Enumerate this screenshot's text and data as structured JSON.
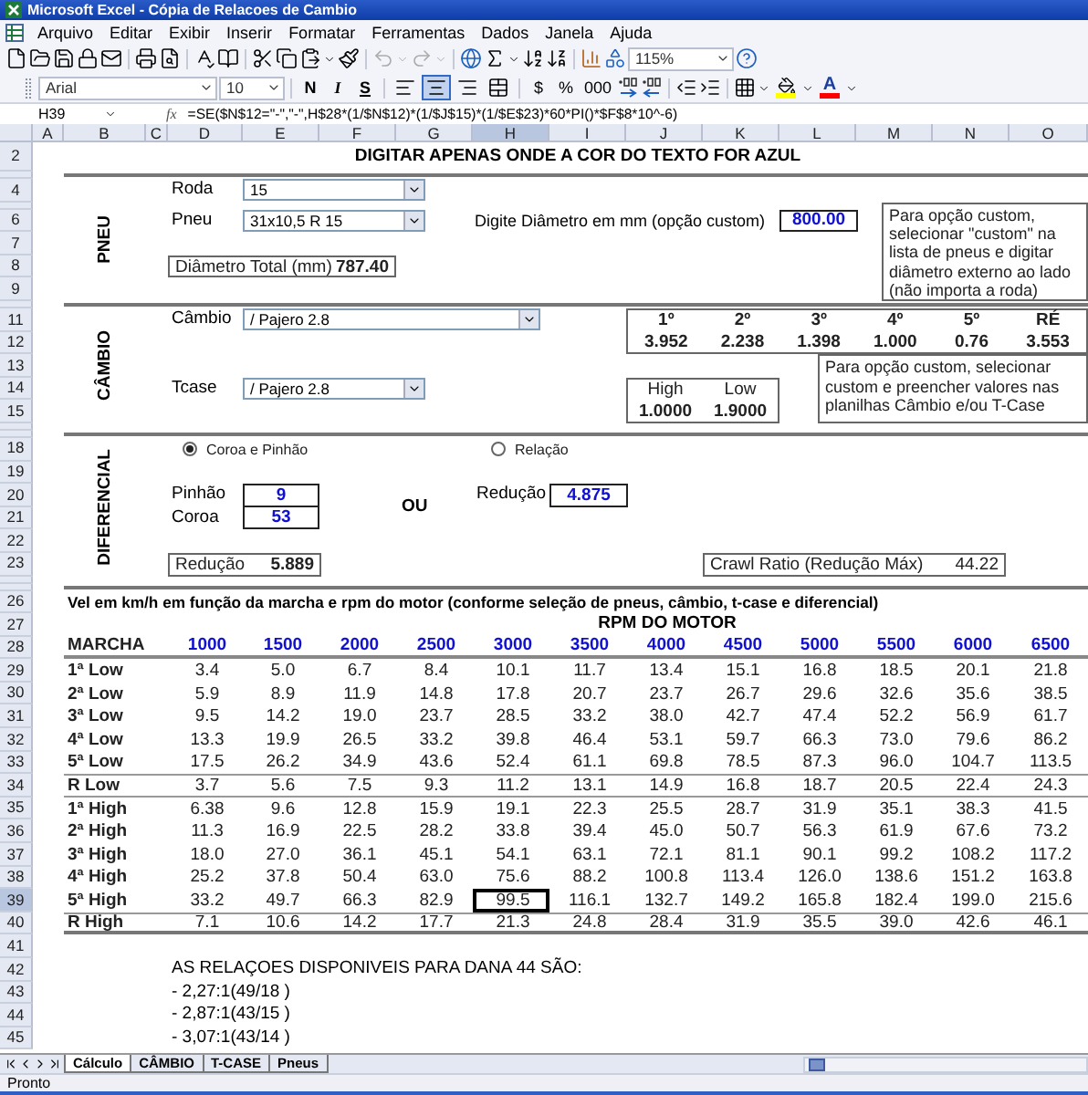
{
  "window": {
    "title": "Microsoft Excel - Cópia de Relacoes de Cambio"
  },
  "menu": [
    "Arquivo",
    "Editar",
    "Exibir",
    "Inserir",
    "Formatar",
    "Ferramentas",
    "Dados",
    "Janela",
    "Ajuda"
  ],
  "standard_toolbar": {
    "zoom": "115%"
  },
  "format_toolbar": {
    "font": "Arial",
    "size": "10",
    "style_buttons": [
      "N",
      "I",
      "S"
    ],
    "alignment_buttons": [
      {
        "kind": "left",
        "selected": false
      },
      {
        "kind": "center",
        "selected": true
      },
      {
        "kind": "right",
        "selected": false
      },
      {
        "kind": "merge",
        "selected": false
      }
    ],
    "number_buttons": [
      "$",
      "%",
      "000"
    ],
    "font_color_label": "A"
  },
  "formula_bar": {
    "name_box": "H39",
    "function_label": "fx",
    "formula": "=SE($N$12=\"-\",\"-\",H$28*(1/$N$12)*(1/$J$15)*(1/$E$23)*60*PI()*$F$8*10^-6)"
  },
  "column_letters": [
    {
      "label": "A",
      "selected": false
    },
    {
      "label": "B",
      "selected": false
    },
    {
      "label": "C",
      "selected": false
    },
    {
      "label": "D",
      "selected": false
    },
    {
      "label": "E",
      "selected": false
    },
    {
      "label": "F",
      "selected": false
    },
    {
      "label": "G",
      "selected": false
    },
    {
      "label": "H",
      "selected": true
    },
    {
      "label": "I",
      "selected": false
    },
    {
      "label": "J",
      "selected": false
    },
    {
      "label": "K",
      "selected": false
    },
    {
      "label": "L",
      "selected": false
    },
    {
      "label": "M",
      "selected": false
    },
    {
      "label": "N",
      "selected": false
    },
    {
      "label": "O",
      "selected": false
    }
  ],
  "row_numbers": [
    {
      "kind": "tall",
      "label": "2",
      "selected": false
    },
    {
      "kind": "collapsed",
      "selected": false
    },
    {
      "kind": "full",
      "label": "4",
      "selected": false
    },
    {
      "kind": "collapsed",
      "selected": false
    },
    {
      "kind": "full",
      "label": "6",
      "selected": false
    },
    {
      "kind": "full",
      "label": "7",
      "selected": false
    },
    {
      "kind": "full",
      "label": "8",
      "selected": false
    },
    {
      "kind": "full",
      "label": "9",
      "selected": false
    },
    {
      "kind": "collapsed",
      "selected": false
    },
    {
      "kind": "full",
      "label": "11",
      "selected": false
    },
    {
      "kind": "full",
      "label": "12",
      "selected": false
    },
    {
      "kind": "full",
      "label": "13",
      "selected": false
    },
    {
      "kind": "full",
      "label": "14",
      "selected": false
    },
    {
      "kind": "full",
      "label": "15",
      "selected": false
    },
    {
      "kind": "collapsed",
      "selected": false
    },
    {
      "kind": "collapsed",
      "selected": false
    },
    {
      "kind": "full",
      "label": "18",
      "selected": false
    },
    {
      "kind": "full",
      "label": "19",
      "selected": false
    },
    {
      "kind": "full",
      "label": "20",
      "selected": false
    },
    {
      "kind": "full",
      "label": "21",
      "selected": false
    },
    {
      "kind": "full",
      "label": "22",
      "selected": false
    },
    {
      "kind": "full",
      "label": "23",
      "selected": false
    },
    {
      "kind": "collapsed",
      "selected": false
    },
    {
      "kind": "collapsed",
      "selected": false
    },
    {
      "kind": "full",
      "label": "26",
      "selected": false
    },
    {
      "kind": "full",
      "label": "27",
      "selected": false
    },
    {
      "kind": "full",
      "label": "28",
      "selected": false
    },
    {
      "kind": "full",
      "label": "29",
      "selected": false
    },
    {
      "kind": "full",
      "label": "30",
      "selected": false
    },
    {
      "kind": "full",
      "label": "31",
      "selected": false
    },
    {
      "kind": "full",
      "label": "32",
      "selected": false
    },
    {
      "kind": "full",
      "label": "33",
      "selected": false
    },
    {
      "kind": "full",
      "label": "34",
      "selected": false
    },
    {
      "kind": "full",
      "label": "35",
      "selected": false
    },
    {
      "kind": "full",
      "label": "36",
      "selected": false
    },
    {
      "kind": "full",
      "label": "37",
      "selected": false
    },
    {
      "kind": "full",
      "label": "38",
      "selected": false
    },
    {
      "kind": "full",
      "label": "39",
      "selected": true
    },
    {
      "kind": "full",
      "label": "40",
      "selected": false
    },
    {
      "kind": "full",
      "label": "41",
      "selected": false
    },
    {
      "kind": "full",
      "label": "42",
      "selected": false
    },
    {
      "kind": "full",
      "label": "43",
      "selected": false
    },
    {
      "kind": "full",
      "label": "44",
      "selected": false
    },
    {
      "kind": "full",
      "label": "45",
      "selected": false
    }
  ],
  "sheet": {
    "heading": "DIGITAR APENAS ONDE A COR DO TEXTO FOR AZUL",
    "tire": {
      "section": "PNEU",
      "wheel_label": "Roda",
      "wheel": "15",
      "tire_label": "Pneu",
      "tire": "31x10,5 R 15",
      "custom_label": "Digite Diâmetro em mm (opção custom)",
      "custom_value": "800.00",
      "total_label": "Diâmetro Total (mm)",
      "total_value": "787.40",
      "note": "Para opção custom, selecionar \"custom\" na lista de pneus e digitar diâmetro externo ao lado (não importa a roda)"
    },
    "gearbox": {
      "section": "CÂMBIO",
      "gearbox_label": "Câmbio",
      "gearbox": "/ Pajero 2.8",
      "gears": [
        {
          "label": "1º",
          "ratio": "3.952"
        },
        {
          "label": "2º",
          "ratio": "2.238"
        },
        {
          "label": "3º",
          "ratio": "1.398"
        },
        {
          "label": "4º",
          "ratio": "1.000"
        },
        {
          "label": "5º",
          "ratio": "0.76"
        },
        {
          "label": "RÉ",
          "ratio": "3.553"
        }
      ],
      "tcase_label": "Tcase",
      "tcase": "/ Pajero 2.8",
      "tcase_ratios": [
        {
          "label": "High",
          "ratio": "1.0000"
        },
        {
          "label": "Low",
          "ratio": "1.9000"
        }
      ],
      "note": "Para opção custom, selecionar custom e preencher valores nas planilhas Câmbio e/ou T-Case"
    },
    "differential": {
      "section": "DIFERENCIAL",
      "modes": [
        {
          "label": "Coroa e Pinhão",
          "selected": true
        },
        {
          "label": "Relação",
          "selected": false
        }
      ],
      "pinion_label": "Pinhão",
      "pinion": "9",
      "crown_label": "Coroa",
      "crown": "53",
      "or_label": "OU",
      "ratio_label": "Redução",
      "ratio": "4.875",
      "reduction_label": "Redução",
      "reduction": "5.889",
      "crawl_label": "Crawl Ratio (Redução Máx)",
      "crawl": "44.22"
    },
    "speed_table": {
      "caption": "Vel em km/h em função da marcha e rpm do motor (conforme seleção de pneus, câmbio, t-case e diferencial)",
      "group_header": "RPM DO MOTOR",
      "row_header": "MARCHA",
      "rpms": [
        "1000",
        "1500",
        "2000",
        "2500",
        "3000",
        "3500",
        "4000",
        "4500",
        "5000",
        "5500",
        "6000",
        "6500"
      ],
      "rows": [
        {
          "kind": "gear",
          "label": "1ª Low",
          "values": [
            "3.4",
            "5.0",
            "6.7",
            "8.4",
            "10.1",
            "11.7",
            "13.4",
            "15.1",
            "16.8",
            "18.5",
            "20.1",
            "21.8"
          ]
        },
        {
          "kind": "gear",
          "label": "2ª Low",
          "values": [
            "5.9",
            "8.9",
            "11.9",
            "14.8",
            "17.8",
            "20.7",
            "23.7",
            "26.7",
            "29.6",
            "32.6",
            "35.6",
            "38.5"
          ]
        },
        {
          "kind": "gear",
          "label": "3ª Low",
          "values": [
            "9.5",
            "14.2",
            "19.0",
            "23.7",
            "28.5",
            "33.2",
            "38.0",
            "42.7",
            "47.4",
            "52.2",
            "56.9",
            "61.7"
          ]
        },
        {
          "kind": "gear",
          "label": "4ª Low",
          "values": [
            "13.3",
            "19.9",
            "26.5",
            "33.2",
            "39.8",
            "46.4",
            "53.1",
            "59.7",
            "66.3",
            "73.0",
            "79.6",
            "86.2"
          ]
        },
        {
          "kind": "gear",
          "label": "5ª Low",
          "values": [
            "17.5",
            "26.2",
            "34.9",
            "43.6",
            "52.4",
            "61.1",
            "69.8",
            "78.5",
            "87.3",
            "96.0",
            "104.7",
            "113.5"
          ]
        },
        {
          "kind": "reverse",
          "label": "R Low",
          "values": [
            "3.7",
            "5.6",
            "7.5",
            "9.3",
            "11.2",
            "13.1",
            "14.9",
            "16.8",
            "18.7",
            "20.5",
            "22.4",
            "24.3"
          ]
        },
        {
          "kind": "gear",
          "label": "1ª High",
          "values": [
            "6.38",
            "9.6",
            "12.8",
            "15.9",
            "19.1",
            "22.3",
            "25.5",
            "28.7",
            "31.9",
            "35.1",
            "38.3",
            "41.5"
          ]
        },
        {
          "kind": "gear",
          "label": "2ª High",
          "values": [
            "11.3",
            "16.9",
            "22.5",
            "28.2",
            "33.8",
            "39.4",
            "45.0",
            "50.7",
            "56.3",
            "61.9",
            "67.6",
            "73.2"
          ]
        },
        {
          "kind": "gear",
          "label": "3ª High",
          "values": [
            "18.0",
            "27.0",
            "36.1",
            "45.1",
            "54.1",
            "63.1",
            "72.1",
            "81.1",
            "90.1",
            "99.2",
            "108.2",
            "117.2"
          ]
        },
        {
          "kind": "gear",
          "label": "4ª High",
          "values": [
            "25.2",
            "37.8",
            "50.4",
            "63.0",
            "75.6",
            "88.2",
            "100.8",
            "113.4",
            "126.0",
            "138.6",
            "151.2",
            "163.8"
          ]
        },
        {
          "kind": "gear",
          "label": "5ª High",
          "values": [
            "33.2",
            "49.7",
            "66.3",
            "82.9",
            "99.5",
            "116.1",
            "132.7",
            "149.2",
            "165.8",
            "182.4",
            "199.0",
            "215.6"
          ]
        },
        {
          "kind": "reverse",
          "label": "R High",
          "values": [
            "7.1",
            "10.6",
            "14.2",
            "17.7",
            "21.3",
            "24.8",
            "28.4",
            "31.9",
            "35.5",
            "39.0",
            "42.6",
            "46.1"
          ]
        }
      ]
    },
    "notes": [
      "AS RELAÇOES DISPONIVEIS PARA DANA 44 SÃO:",
      "- 2,27:1(49/18 )",
      "- 2,87:1(43/15 )",
      "- 3,07:1(43/14 )"
    ]
  },
  "sheet_tabs": [
    {
      "label": "Cálculo",
      "selected": true
    },
    {
      "label": "CÂMBIO",
      "selected": false
    },
    {
      "label": "T-CASE",
      "selected": false
    },
    {
      "label": "Pneus",
      "selected": false
    }
  ],
  "status_bar": {
    "text": "Pronto"
  }
}
